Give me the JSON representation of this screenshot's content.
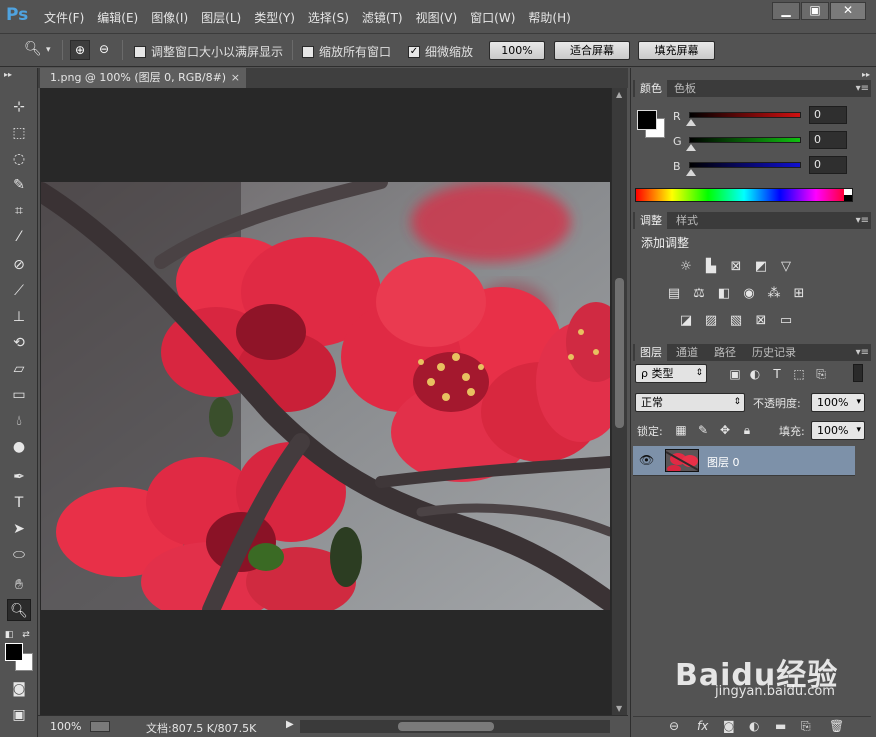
{
  "app": {
    "logo": "Ps",
    "menu": [
      "文件(F)",
      "编辑(E)",
      "图像(I)",
      "图层(L)",
      "类型(Y)",
      "选择(S)",
      "滤镜(T)",
      "视图(V)",
      "窗口(W)",
      "帮助(H)"
    ],
    "window_controls": {
      "minimize": "▁",
      "restore": "▣",
      "close": "✕"
    }
  },
  "options": {
    "resize_windows_label": "调整窗口大小以满屏显示",
    "resize_windows_checked": false,
    "zoom_all_label": "缩放所有窗口",
    "zoom_all_checked": false,
    "scrubby_label": "细微缩放",
    "scrubby_checked": true,
    "btn_100": "100%",
    "btn_fit": "适合屏幕",
    "btn_fill": "填充屏幕"
  },
  "document": {
    "tab_title": "1.png @ 100% (图层 0, RGB/8#)",
    "tab_close": "×",
    "status_zoom": "100%",
    "status_doc": "文档:807.5 K/807.5K"
  },
  "color_panel": {
    "tabs": [
      "颜色",
      "色板"
    ],
    "channels": [
      {
        "label": "R",
        "value": "0",
        "color": "#d01010"
      },
      {
        "label": "G",
        "value": "0",
        "color": "#10c010"
      },
      {
        "label": "B",
        "value": "0",
        "color": "#1010d0"
      }
    ]
  },
  "adjust_panel": {
    "tabs": [
      "调整",
      "样式"
    ],
    "title": "添加调整"
  },
  "layers_panel": {
    "tabs": [
      "图层",
      "通道",
      "路径",
      "历史记录"
    ],
    "filter_type": "ρ 类型",
    "blend_mode": "正常",
    "opacity_label": "不透明度:",
    "opacity_value": "100%",
    "lock_label": "锁定:",
    "fill_label": "填充:",
    "fill_value": "100%",
    "layer_name": "图层 0"
  },
  "watermark": {
    "brand": "Baidu经验",
    "url": "jingyan.baidu.com"
  }
}
